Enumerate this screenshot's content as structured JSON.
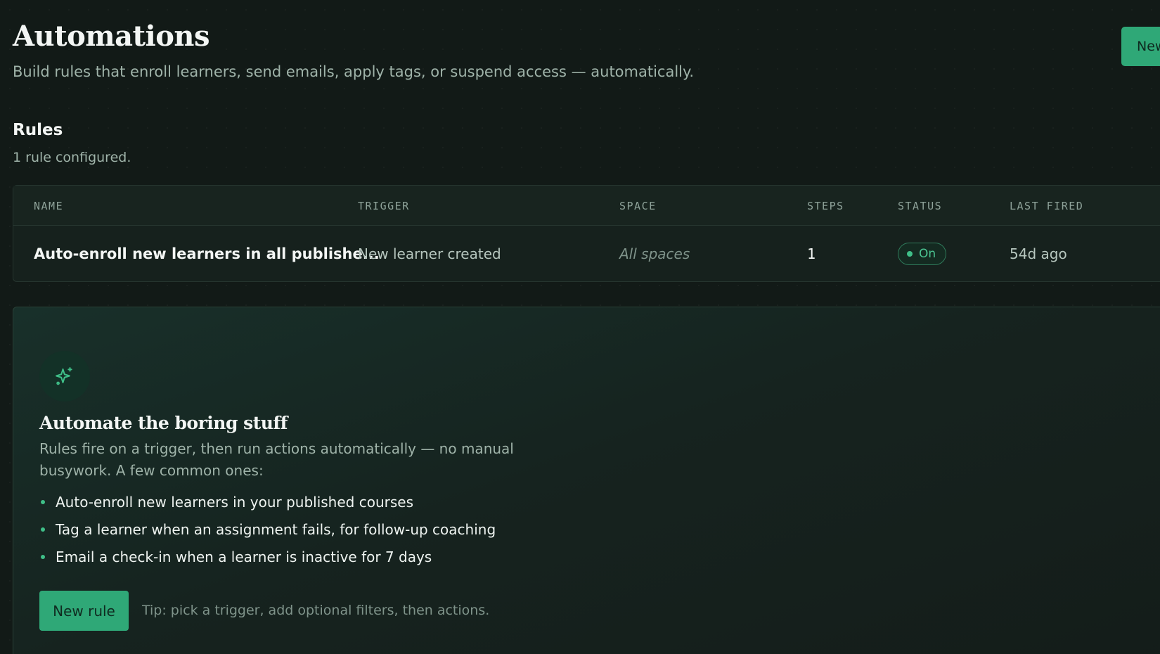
{
  "header": {
    "title": "Automations",
    "subtitle": "Build rules that enroll learners, send emails, apply tags, or suspend access — automatically.",
    "new_button_label": "New rule"
  },
  "rules": {
    "title": "Rules",
    "count_text": "1 rule configured.",
    "columns": [
      "NAME",
      "TRIGGER",
      "SPACE",
      "STEPS",
      "STATUS",
      "LAST FIRED"
    ],
    "rows": [
      {
        "name": "Auto-enroll new learners in all publishe...",
        "trigger": "New learner created",
        "space": "All spaces",
        "steps": "1",
        "status": "On",
        "last_fired": "54d ago"
      }
    ]
  },
  "empty_state": {
    "icon": "sparkle-icon",
    "title": "Automate the boring stuff",
    "description": "Rules fire on a trigger, then run actions automatically — no manual busywork. A few common ones:",
    "examples": [
      "Auto-enroll new learners in your published courses",
      "Tag a learner when an assignment fails, for follow-up coaching",
      "Email a check-in when a learner is inactive for 7 days"
    ],
    "button_label": "New rule",
    "tip": "Tip: pick a trigger, add optional filters, then actions."
  },
  "colors": {
    "background": "#121a17",
    "accent": "#2fa877",
    "status_on": "#4cc593"
  }
}
